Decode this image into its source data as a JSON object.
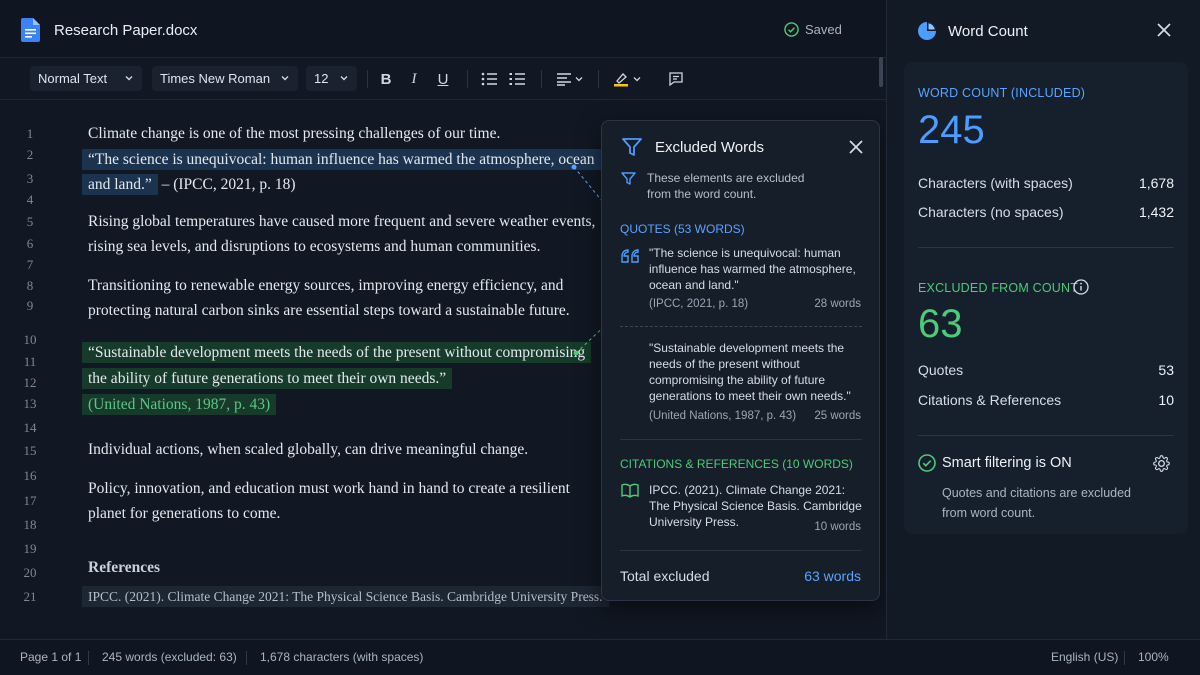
{
  "app": {
    "doc_title": "Research Paper.docx",
    "saved_label": "Saved"
  },
  "toolbar": {
    "style_value": "Normal Text",
    "font_value": "Times New Roman",
    "size_value": "12",
    "bold_label": "B",
    "italic_label": "I",
    "underline_label": "U"
  },
  "editor": {
    "line_numbers": [
      "1",
      "2",
      "3",
      "4",
      "5",
      "6",
      "7",
      "8",
      "9",
      "10",
      "11",
      "12",
      "13",
      "14",
      "15",
      "16",
      "17",
      "18",
      "19",
      "20",
      "21"
    ],
    "p1": "Climate change is one of the most pressing challenges of our time.",
    "quote1_line1": "“The science is unequivocal: human influence has warmed the atmosphere, ocean",
    "quote1_line2": "and land.”",
    "quote1_cite": " – (IPCC, 2021, p. 18)",
    "p2_line1": "Rising global temperatures have caused more frequent and severe weather events,",
    "p2_line2": "rising sea levels, and disruptions to ecosystems and human communities.",
    "p3_line1": "Transitioning to renewable energy sources, improving energy efficiency, and",
    "p3_line2": "protecting natural carbon sinks are essential steps toward a sustainable future.",
    "quote2_line1": "“Sustainable development meets the needs of the present without compromising",
    "quote2_line2": "the ability of future generations to meet their own needs.”",
    "quote2_cite": "(United Nations, 1987, p. 43)",
    "p4": "Individual actions, when scaled globally, can drive meaningful change.",
    "p5_line1": "Policy, innovation, and education must work hand in hand to create a resilient",
    "p5_line2": "planet for generations to come.",
    "references_title": "References",
    "reference1": "IPCC. (2021). Climate Change 2021: The Physical Science Basis. Cambridge University Press."
  },
  "popup": {
    "title": "Excluded Words",
    "description": "These elements are excluded from the word count.",
    "quotes_header": "QUOTES (53 WORDS)",
    "quotes": [
      {
        "text": "\"The science is unequivocal: human influence has warmed the atmosphere, ocean and land.\"",
        "cite": "(IPCC, 2021, p. 18)",
        "words": "28 words"
      },
      {
        "text": "\"Sustainable development meets the needs of the present without compromising the ability of future generations to meet their own needs.\"",
        "cite": "(United Nations, 1987, p. 43)",
        "words": "25 words"
      }
    ],
    "citations_header": "CITATIONS & REFERENCES (10 WORDS)",
    "citation_text": "IPCC. (2021). Climate Change 2021: The Physical Science Basis. Cambridge University Press.",
    "citation_words": "10 words",
    "total_label": "Total excluded",
    "total_value": "63 words"
  },
  "panel": {
    "title": "Word Count",
    "included_label": "WORD COUNT (INCLUDED)",
    "included_value": "245",
    "chars_spaces_label": "Characters (with spaces)",
    "chars_spaces_value": "1,678",
    "chars_nospaces_label": "Characters (no spaces)",
    "chars_nospaces_value": "1,432",
    "excluded_label": "EXCLUDED FROM COUNT",
    "excluded_value": "63",
    "quotes_label": "Quotes",
    "quotes_value": "53",
    "citations_label": "Citations & References",
    "citations_value": "10",
    "smart_label": "Smart filtering is ON",
    "smart_desc": "Quotes and citations are excluded from word count."
  },
  "status": {
    "page": "Page 1 of 1",
    "words": "245 words (excluded: 63)",
    "chars": "1,678 characters (with spaces)",
    "language": "English (US)",
    "zoom": "100%"
  },
  "colors": {
    "accent_blue": "#4d9cff",
    "accent_green": "#4ccb78",
    "quote_highlight_blue": "#1c3350",
    "quote_highlight_green": "#173b2a"
  },
  "icons": [
    "doc-icon",
    "check-circle-icon",
    "chevron-down-icon",
    "bullet-list-icon",
    "numbered-list-icon",
    "align-icon",
    "highlighter-icon",
    "comment-icon",
    "filter-icon",
    "close-icon",
    "quote-mark-icon",
    "book-icon",
    "pie-chart-icon",
    "info-icon",
    "gear-icon"
  ]
}
